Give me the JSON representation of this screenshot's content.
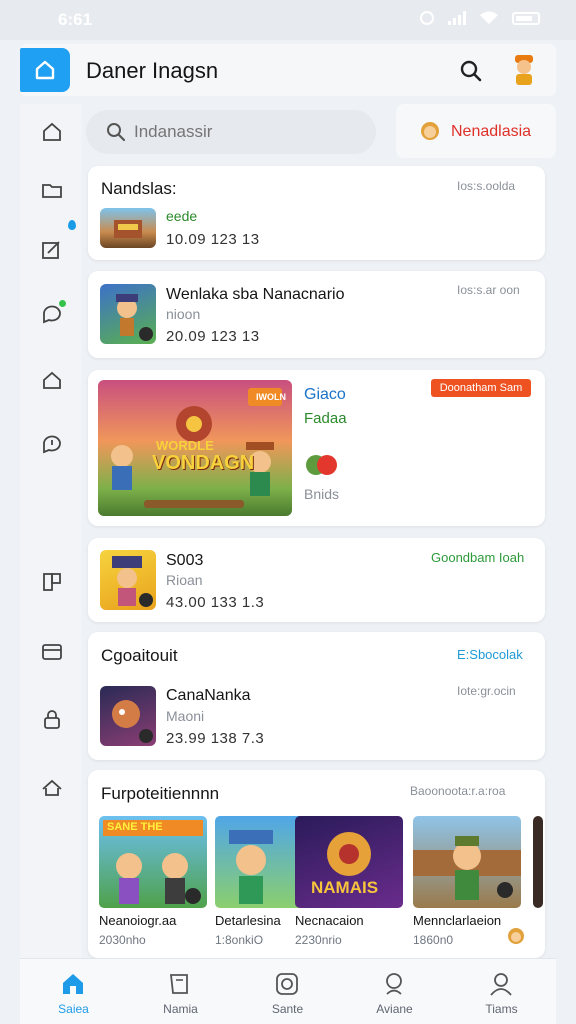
{
  "status_bar": {
    "time": "6:61"
  },
  "header": {
    "title": "Daner Inagsn"
  },
  "search": {
    "placeholder": "Indanassir"
  },
  "profile": {
    "name": "Nenadlasia"
  },
  "cards": [
    {
      "title": "Nandslas:",
      "meta": "Ios:s.oolda",
      "sub": "eede",
      "nums": "10.09  123 13"
    },
    {
      "title": "Wenlaka sba Nanacnario",
      "meta": "Ios:s.ar oon",
      "sub": "nioon",
      "nums": "20.09  123 13"
    },
    {
      "art_title": "VONDAGN",
      "art_top": "WORDLE",
      "badge": "IWOLN",
      "sub1": "Giaco",
      "sub2": "Fadaa",
      "sub3": "Bnids",
      "promo": "Doonatham Sam"
    },
    {
      "title": "S003",
      "sub": "Rioan",
      "nums": "43.00  133 1.3",
      "meta": "Goondbam Ioah"
    },
    {
      "section": "Cgoaitouit",
      "link": "E:Sbocolak",
      "title": "CanaNanka",
      "sub": "Maoni",
      "nums": "23.99  138 7.3",
      "meta": "Iote:gr.ocin"
    },
    {
      "section": "Furpoteitiennnn",
      "meta": "Baoonoota:r.a:roa",
      "tiles": [
        {
          "name": "Neanoiogr.aa",
          "count": "2030nho",
          "art": "SANE THE"
        },
        {
          "name": "Detarlesina",
          "count": "1:8onkiO",
          "art": ""
        },
        {
          "name": "Necnacaion",
          "count": "2230nrio",
          "art": "NAMAIS"
        },
        {
          "name": "Mennclarlaeion",
          "count": "1860n0",
          "art": ""
        }
      ]
    }
  ],
  "bottom_nav": [
    {
      "label": "Saiea",
      "icon": "home-icon",
      "active": true
    },
    {
      "label": "Namia",
      "icon": "book-icon",
      "active": false
    },
    {
      "label": "Sante",
      "icon": "camera-icon",
      "active": false
    },
    {
      "label": "Aviane",
      "icon": "search-person-icon",
      "active": false
    },
    {
      "label": "Tiams",
      "icon": "profile-icon",
      "active": false
    }
  ],
  "colors": {
    "accent": "#1e9be8",
    "profile_red": "#e0302a",
    "badge_orange": "#ee5220",
    "green": "#34c24a"
  }
}
